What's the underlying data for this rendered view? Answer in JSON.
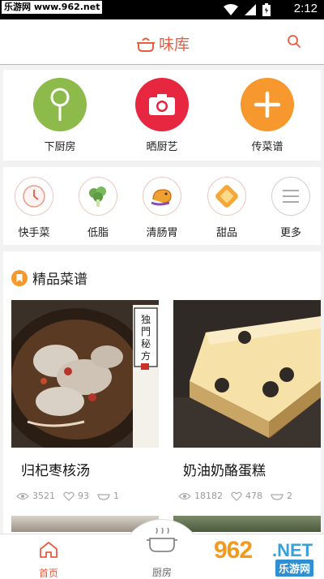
{
  "status_bar": {
    "watermark": "乐游网 www.962.net",
    "time": "2:12"
  },
  "header": {
    "title": "味库"
  },
  "categories": [
    {
      "label": "下厨房",
      "color": "#8dbb4b",
      "icon": "spoon-icon"
    },
    {
      "label": "晒厨艺",
      "color": "#e7263f",
      "icon": "camera-icon"
    },
    {
      "label": "传菜谱",
      "color": "#f6982e",
      "icon": "plus-icon"
    }
  ],
  "quick_links": [
    {
      "label": "快手菜",
      "icon": "clock-icon"
    },
    {
      "label": "低脂",
      "icon": "broccoli-icon"
    },
    {
      "label": "清肠胃",
      "icon": "shrimp-icon"
    },
    {
      "label": "甜品",
      "icon": "pudding-icon"
    },
    {
      "label": "更多",
      "icon": "menu-icon"
    }
  ],
  "section": {
    "title": "精品菜谱"
  },
  "recipes": [
    {
      "name": "归杞枣核汤",
      "views": "3521",
      "likes": "93",
      "comments": "1",
      "badge": "独門秘方"
    },
    {
      "name": "奶油奶酪蛋糕",
      "views": "18182",
      "likes": "478",
      "comments": "2"
    }
  ],
  "tabs": [
    {
      "label": "首页",
      "active": true
    },
    {
      "label": "厨房",
      "active": false
    }
  ],
  "watermark": {
    "big": "962",
    "net": ".NET",
    "sub": "乐游网"
  },
  "colors": {
    "accent": "#ea5b3f",
    "tab_active": "#ea5b3f"
  }
}
